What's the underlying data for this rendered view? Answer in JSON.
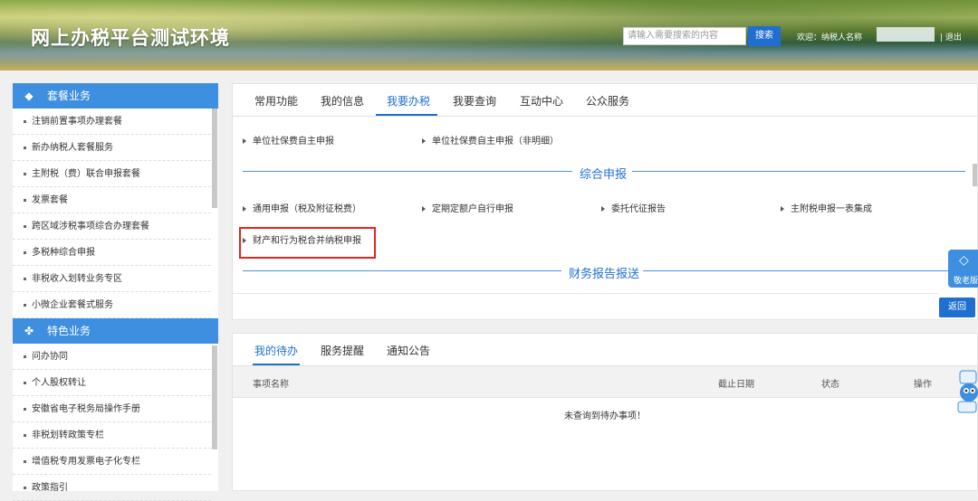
{
  "header": {
    "title": "网上办税平台测试环境",
    "search_placeholder": "请输入需要搜索的内容",
    "search_button": "搜索",
    "welcome": "欢迎：纳税人名称",
    "logout": "| 退出"
  },
  "sidebar": {
    "package_title": "套餐业务",
    "package_items": [
      "注销前置事项办理套餐",
      "新办纳税人套餐服务",
      "主附税（费）联合申报套餐",
      "发票套餐",
      "跨区域涉税事项综合办理套餐",
      "多税种综合申报",
      "非税收入划转业务专区",
      "小微企业套餐式服务"
    ],
    "special_title": "特色业务",
    "special_items": [
      "问办协同",
      "个人股权转让",
      "安徽省电子税务局操作手册",
      "非税划转政策专栏",
      "增值税专用发票电子化专栏",
      "政策指引"
    ]
  },
  "main": {
    "tabs": [
      "常用功能",
      "我的信息",
      "我要办税",
      "我要查询",
      "互动中心",
      "公众服务"
    ],
    "active_tab": "我要办税",
    "top_links": [
      "单位社保费自主申报",
      "单位社保费自主申报（非明细）"
    ],
    "section1_title": "综合申报",
    "section1_links": [
      "通用申报（税及附征税费）",
      "定期定额户自行申报",
      "委托代征报告",
      "主附税申报一表集成"
    ],
    "highlighted_link": "财产和行为税合并纳税申报",
    "section2_title": "财务报告报送",
    "back_button": "返回"
  },
  "float_widget": {
    "label": "敬老版",
    "icon": "diamond-arrow-icon"
  },
  "todo": {
    "tabs": [
      "我的待办",
      "服务提醒",
      "通知公告"
    ],
    "active_tab": "我的待办",
    "columns": [
      "事项名称",
      "截止日期",
      "状态",
      "操作"
    ],
    "empty_message": "未查询到待办事项！"
  },
  "colors": {
    "primary": "#1f6fd0",
    "sidebar_head": "#3e8fe0",
    "highlight_border": "#e1251b"
  }
}
